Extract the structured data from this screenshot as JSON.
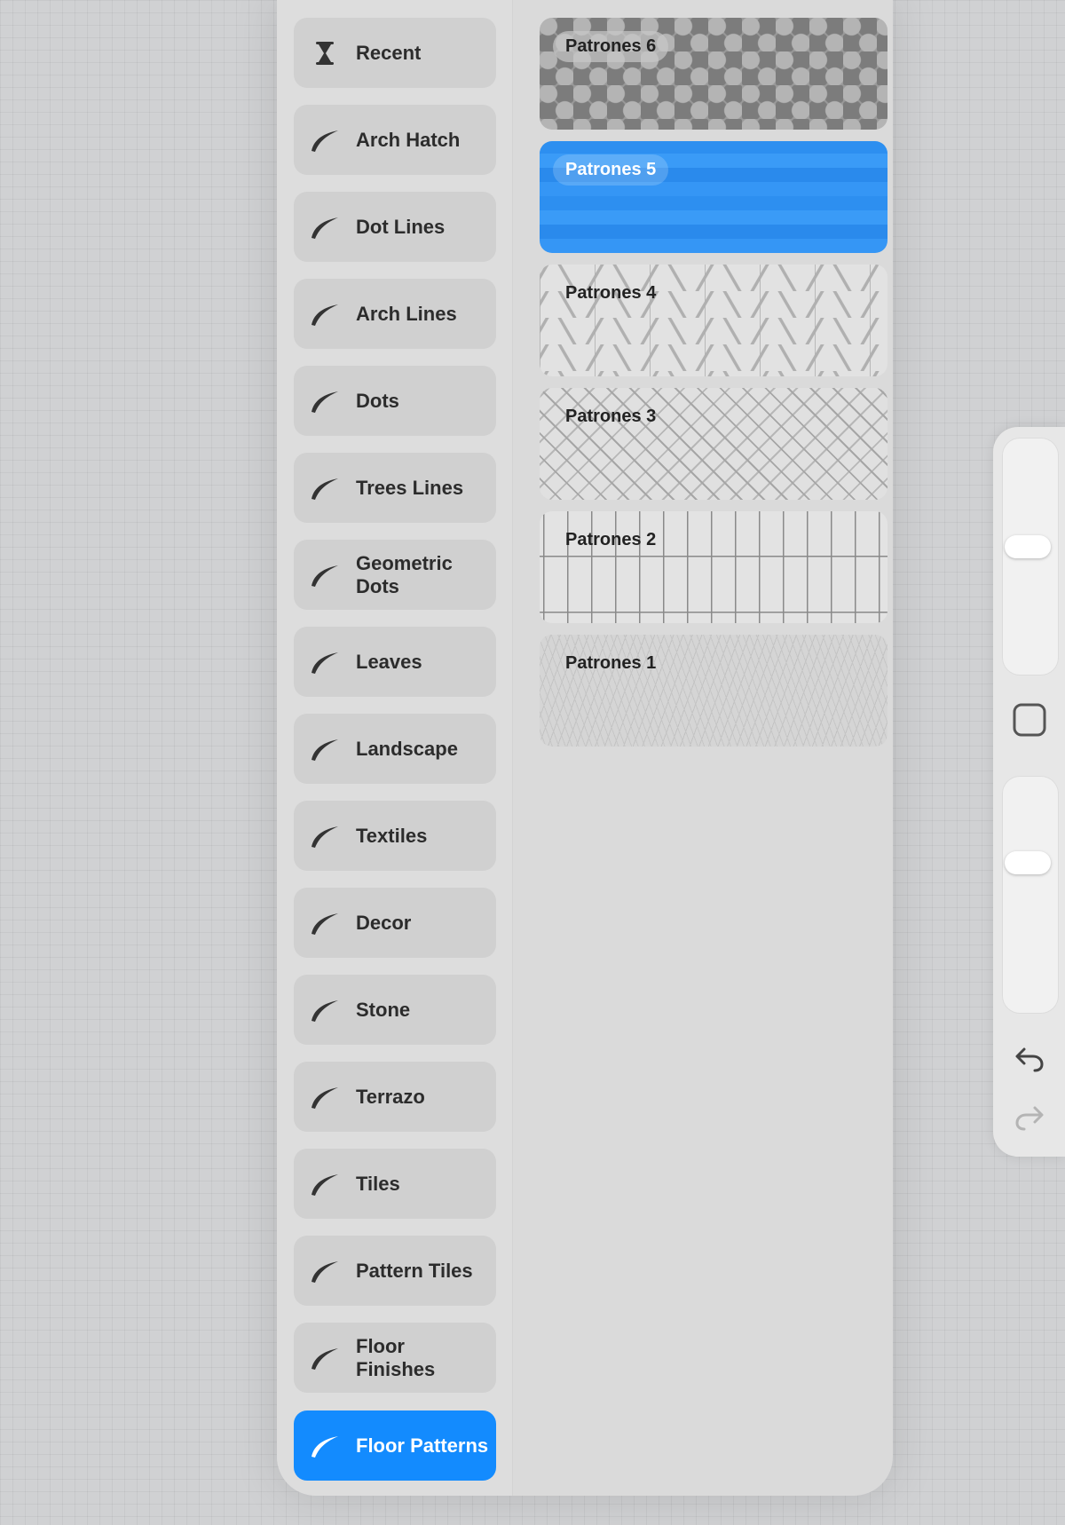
{
  "brush_sets": [
    {
      "label": "Recent",
      "icon": "hourglass-icon",
      "active": false
    },
    {
      "label": "Arch Hatch",
      "icon": "brush-stroke-icon",
      "active": false
    },
    {
      "label": "Dot Lines",
      "icon": "brush-stroke-icon",
      "active": false
    },
    {
      "label": "Arch Lines",
      "icon": "brush-stroke-icon",
      "active": false
    },
    {
      "label": "Dots",
      "icon": "brush-stroke-icon",
      "active": false
    },
    {
      "label": "Trees Lines",
      "icon": "brush-stroke-icon",
      "active": false
    },
    {
      "label": "Geometric Dots",
      "icon": "brush-stroke-icon",
      "active": false
    },
    {
      "label": "Leaves",
      "icon": "brush-stroke-icon",
      "active": false
    },
    {
      "label": "Landscape",
      "icon": "brush-stroke-icon",
      "active": false
    },
    {
      "label": "Textiles",
      "icon": "brush-stroke-icon",
      "active": false
    },
    {
      "label": "Decor",
      "icon": "brush-stroke-icon",
      "active": false
    },
    {
      "label": "Stone",
      "icon": "brush-stroke-icon",
      "active": false
    },
    {
      "label": "Terrazo",
      "icon": "brush-stroke-icon",
      "active": false
    },
    {
      "label": "Tiles",
      "icon": "brush-stroke-icon",
      "active": false
    },
    {
      "label": "Pattern Tiles",
      "icon": "brush-stroke-icon",
      "active": false
    },
    {
      "label": "Floor Finishes",
      "icon": "brush-stroke-icon",
      "active": false
    },
    {
      "label": "Floor Patterns",
      "icon": "brush-stroke-icon",
      "active": true
    }
  ],
  "brushes": [
    {
      "name": "Patrones 6",
      "selected": false
    },
    {
      "name": "Patrones 5",
      "selected": true
    },
    {
      "name": "Patrones 4",
      "selected": false
    },
    {
      "name": "Patrones 3",
      "selected": false
    },
    {
      "name": "Patrones 2",
      "selected": false
    },
    {
      "name": "Patrones 1",
      "selected": false
    }
  ],
  "sidebar_controls": {
    "brush_size": 0.55,
    "brush_opacity": 0.66,
    "modify_button_icon": "square-icon",
    "undo_icon": "undo-icon",
    "redo_icon": "redo-icon"
  },
  "colors": {
    "accent": "#138bfe",
    "panel": "#dadada",
    "set_button": "#d0d0d0",
    "text": "#2c2c2c"
  }
}
